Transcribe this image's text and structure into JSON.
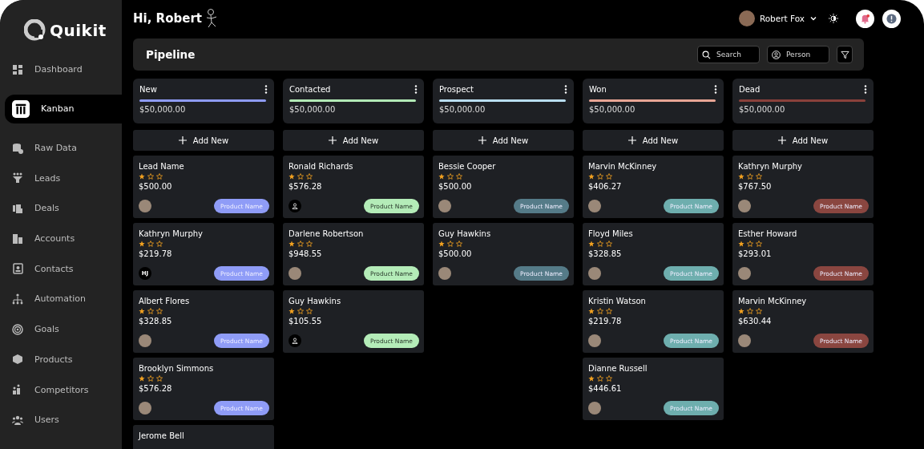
{
  "brand": {
    "name": "Quikit"
  },
  "sidebar": {
    "items": [
      {
        "label": "Dashboard",
        "selected": false
      },
      {
        "label": "Kanban",
        "selected": true
      },
      {
        "label": "Raw Data",
        "selected": false
      },
      {
        "label": "Leads",
        "selected": false
      },
      {
        "label": "Deals",
        "selected": false
      },
      {
        "label": "Accounts",
        "selected": false
      },
      {
        "label": "Contacts",
        "selected": false
      },
      {
        "label": "Automation",
        "selected": false
      },
      {
        "label": "Goals",
        "selected": false
      },
      {
        "label": "Products",
        "selected": false
      },
      {
        "label": "Competitors",
        "selected": false
      },
      {
        "label": "Users",
        "selected": false
      }
    ]
  },
  "header": {
    "greeting": "Hi, Robert",
    "user_name": "Robert Fox",
    "notification_unread": true
  },
  "toolbar": {
    "title": "Pipeline",
    "search": {
      "placeholder": "Search"
    },
    "person": {
      "placeholder": "Person"
    }
  },
  "columns": [
    {
      "title": "New",
      "color": "#8e9bf5",
      "amount": "$50,000.00",
      "add_label": "Add New",
      "cards": [
        {
          "name": "Lead Name",
          "stars": 1,
          "amount": "$500.00",
          "avatar": {
            "kind": "photo"
          },
          "tag": {
            "text": "Product Name",
            "color": "#8f9cf7"
          }
        },
        {
          "name": "Kathryn Murphy",
          "stars": 1,
          "amount": "$219.78",
          "avatar": {
            "kind": "initials",
            "text": "HJ"
          },
          "tag": {
            "text": "Product Name",
            "color": "#8f9cf7"
          }
        },
        {
          "name": "Albert Flores",
          "stars": 1,
          "amount": "$328.85",
          "avatar": {
            "kind": "photo"
          },
          "tag": {
            "text": "Product Name",
            "color": "#8f9cf7"
          }
        },
        {
          "name": "Brooklyn Simmons",
          "stars": 1,
          "amount": "$576.28",
          "avatar": {
            "kind": "photo"
          },
          "tag": {
            "text": "Product Name",
            "color": "#8f9cf7"
          }
        },
        {
          "name": "Jerome Bell"
        }
      ]
    },
    {
      "title": "Contacted",
      "color": "#b2eab6",
      "amount": "$50,000.00",
      "add_label": "Add New",
      "cards": [
        {
          "name": "Ronald Richards",
          "stars": 1,
          "amount": "$576.28",
          "avatar": {
            "kind": "icon"
          },
          "tag": {
            "text": "Product Name",
            "color": "#b4ecb8"
          }
        },
        {
          "name": "Darlene Robertson",
          "stars": 1,
          "amount": "$948.55",
          "avatar": {
            "kind": "photo"
          },
          "tag": {
            "text": "Product Name",
            "color": "#b4ecb8"
          }
        },
        {
          "name": "Guy Hawkins",
          "stars": 1,
          "amount": "$105.55",
          "avatar": {
            "kind": "icon"
          },
          "tag": {
            "text": "Product Name",
            "color": "#b4ecb8"
          }
        }
      ]
    },
    {
      "title": "Prospect",
      "color": "#b9def0",
      "amount": "$50,000.00",
      "add_label": "Add New",
      "cards": [
        {
          "name": "Bessie Cooper",
          "stars": 1,
          "amount": "$500.00",
          "avatar": {
            "kind": "photo"
          },
          "tag": {
            "text": "Product Name",
            "color": "#557b88"
          }
        },
        {
          "name": "Guy Hawkins",
          "stars": 1,
          "amount": "$500.00",
          "avatar": {
            "kind": "photo"
          },
          "tag": {
            "text": "Product Name",
            "color": "#557b88"
          }
        }
      ]
    },
    {
      "title": "Won",
      "color": "#e8a595",
      "amount": "$50,000.00",
      "add_label": "Add New",
      "cards": [
        {
          "name": "Marvin McKinney",
          "stars": 1,
          "amount": "$406.27",
          "avatar": {
            "kind": "photo"
          },
          "tag": {
            "text": "Product Name",
            "color": "#6eaeae"
          }
        },
        {
          "name": "Floyd Miles",
          "stars": 1,
          "amount": "$328.85",
          "avatar": {
            "kind": "photo"
          },
          "tag": {
            "text": "Product Name",
            "color": "#6eaeae"
          }
        },
        {
          "name": "Kristin Watson",
          "stars": 1,
          "amount": "$219.78",
          "avatar": {
            "kind": "photo"
          },
          "tag": {
            "text": "Product Name",
            "color": "#6eaeae"
          }
        },
        {
          "name": "Dianne Russell",
          "stars": 1,
          "amount": "$446.61",
          "avatar": {
            "kind": "photo"
          },
          "tag": {
            "text": "Product Name",
            "color": "#6eaeae"
          }
        }
      ]
    },
    {
      "title": "Dead",
      "color": "#8a413b",
      "amount": "$50,000.00",
      "add_label": "Add New",
      "cards": [
        {
          "name": "Kathryn Murphy",
          "stars": 1,
          "amount": "$767.50",
          "avatar": {
            "kind": "photo"
          },
          "tag": {
            "text": "Product Name",
            "color": "#8a4640"
          }
        },
        {
          "name": "Esther Howard",
          "stars": 1,
          "amount": "$293.01",
          "avatar": {
            "kind": "photo"
          },
          "tag": {
            "text": "Product Name",
            "color": "#8a4640"
          }
        },
        {
          "name": "Marvin McKinney",
          "stars": 1,
          "amount": "$630.44",
          "avatar": {
            "kind": "photo"
          },
          "tag": {
            "text": "Product Name",
            "color": "#8a4640"
          }
        }
      ]
    }
  ]
}
